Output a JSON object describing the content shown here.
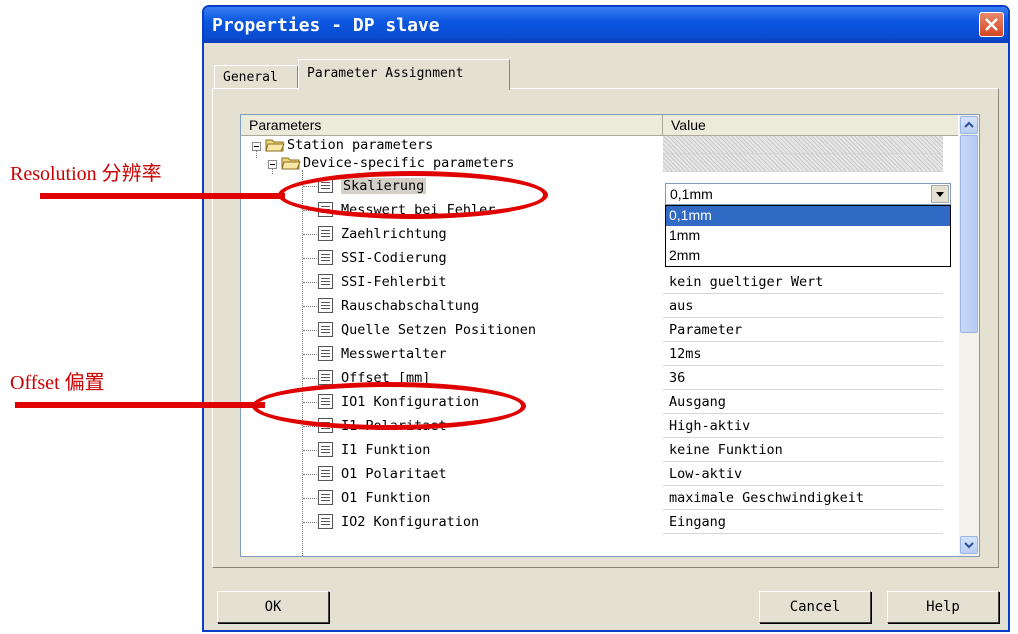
{
  "window": {
    "title": "Properties - DP slave",
    "close_icon": "close-icon"
  },
  "tabs": [
    {
      "label": "General",
      "active": false
    },
    {
      "label": "Parameter Assignment",
      "active": true
    }
  ],
  "grid": {
    "col_parameters": "Parameters",
    "col_value": "Value",
    "station_parameters": "Station parameters",
    "device_specific": "Device-specific parameters",
    "rows": [
      {
        "name": "Skalierung",
        "value": "0,1mm"
      },
      {
        "name": "Messwert bei Fehler",
        "value": ""
      },
      {
        "name": "Zaehlrichtung",
        "value": ""
      },
      {
        "name": "SSI-Codierung",
        "value": ""
      },
      {
        "name": "SSI-Fehlerbit",
        "value": "kein gueltiger Wert"
      },
      {
        "name": "Rauschabschaltung",
        "value": "aus"
      },
      {
        "name": "Quelle Setzen Positionen",
        "value": "Parameter"
      },
      {
        "name": "Messwertalter",
        "value": "12ms"
      },
      {
        "name": "Offset [mm]",
        "value": "36"
      },
      {
        "name": "IO1 Konfiguration",
        "value": "Ausgang"
      },
      {
        "name": "I1 Polaritaet",
        "value": "High-aktiv"
      },
      {
        "name": "I1 Funktion",
        "value": "keine Funktion"
      },
      {
        "name": "O1 Polaritaet",
        "value": "Low-aktiv"
      },
      {
        "name": "O1 Funktion",
        "value": "maximale Geschwindigkeit"
      },
      {
        "name": "IO2 Konfiguration",
        "value": "Eingang"
      }
    ],
    "select_value": "0,1mm",
    "dropdown_options": [
      "0,1mm",
      "1mm",
      "2mm"
    ]
  },
  "buttons": {
    "ok": "OK",
    "cancel": "Cancel",
    "help": "Help"
  },
  "annotations": {
    "resolution": "Resolution  分辨率",
    "offset": "Offset  偏置"
  },
  "colors": {
    "titlebar": "#0b57e0",
    "selection": "#316ac5",
    "annotation": "#e10000"
  }
}
